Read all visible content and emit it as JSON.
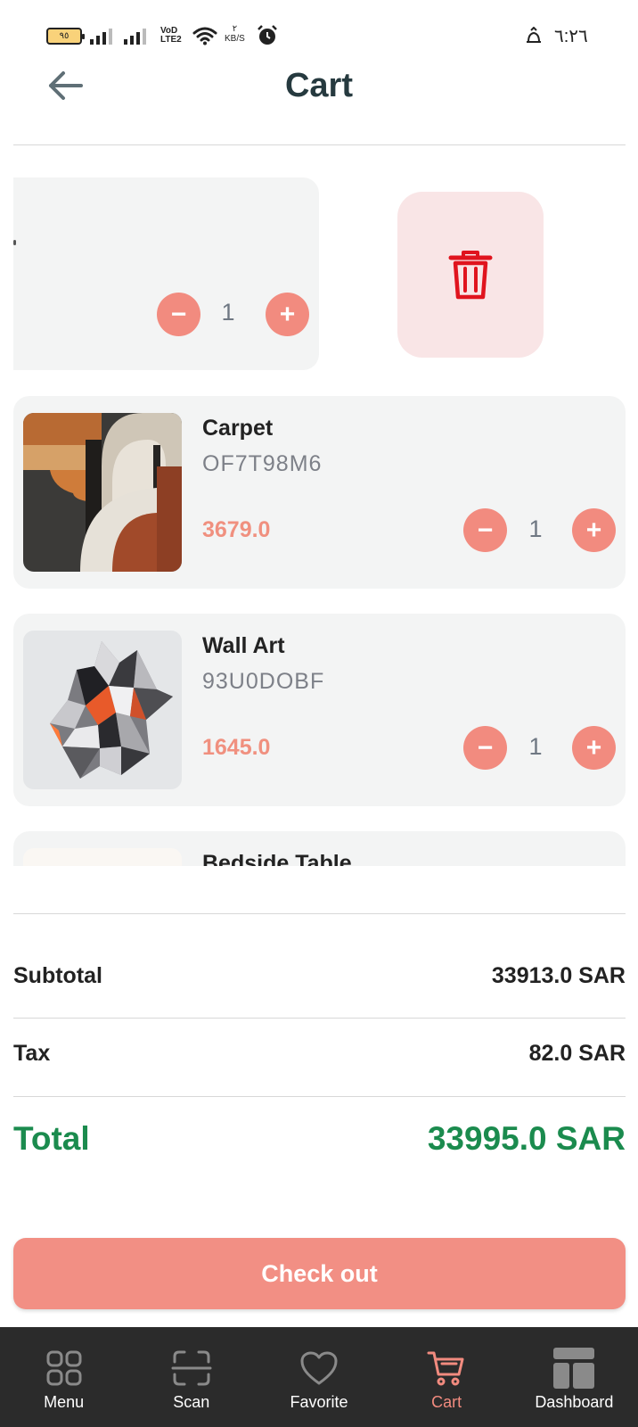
{
  "status_bar": {
    "battery": "٩٥",
    "volte": "VoD LTE2",
    "speed_value": "٢",
    "speed_unit": "KB/S",
    "clock": "٦:٢٦"
  },
  "header": {
    "title": "Cart",
    "back_icon": "arrow-left-icon"
  },
  "cart": {
    "swiped_item": {
      "quantity": "1",
      "minus": "−",
      "plus": "+",
      "delete_icon": "trash-icon"
    },
    "items": [
      {
        "name": "Carpet",
        "code": "OF7T98M6",
        "price": "3679.0",
        "quantity": "1",
        "minus": "−",
        "plus": "+"
      },
      {
        "name": "Wall Art",
        "code": "93U0DOBF",
        "price": "1645.0",
        "quantity": "1",
        "minus": "−",
        "plus": "+"
      },
      {
        "name": "Bedside Table"
      }
    ]
  },
  "summary": {
    "subtotal_label": "Subtotal",
    "subtotal_value": "33913.0 SAR",
    "tax_label": "Tax",
    "tax_value": "82.0 SAR",
    "total_label": "Total",
    "total_value": "33995.0 SAR"
  },
  "checkout": {
    "label": "Check out"
  },
  "nav": {
    "items": [
      {
        "label": "Menu",
        "icon": "grid-icon"
      },
      {
        "label": "Scan",
        "icon": "scan-icon"
      },
      {
        "label": "Favorite",
        "icon": "heart-icon"
      },
      {
        "label": "Cart",
        "icon": "cart-icon",
        "active": true
      },
      {
        "label": "Dashboard",
        "icon": "dashboard-icon"
      }
    ]
  },
  "colors": {
    "accent": "#f28b7f",
    "total_green": "#1b8b4e",
    "card_bg": "#f3f4f4",
    "delete_bg": "#f9e5e6",
    "delete_icon": "#e0141e",
    "nav_bg": "#2b2b2b"
  }
}
